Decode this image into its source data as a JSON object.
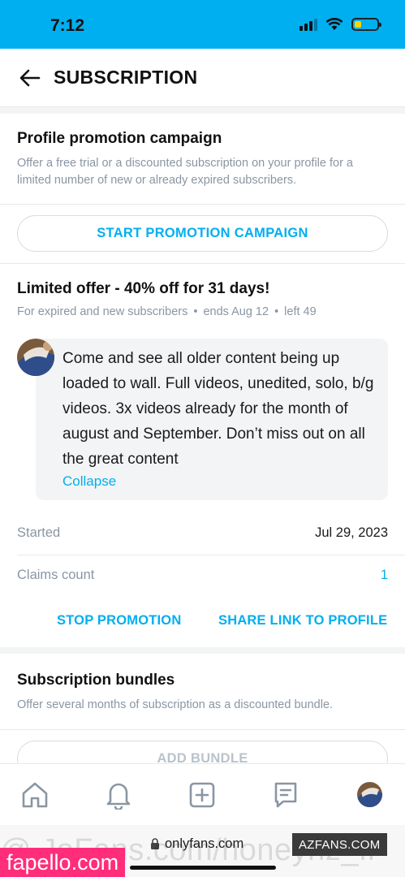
{
  "status_bar": {
    "time": "7:12"
  },
  "header": {
    "title": "SUBSCRIPTION",
    "back_icon": "arrow-left-icon"
  },
  "promotion": {
    "title": "Profile promotion campaign",
    "description": "Offer a free trial or a discounted subscription on your profile for a limited number of new or already expired subscribers.",
    "start_button": "START PROMOTION CAMPAIGN"
  },
  "offer": {
    "title": "Limited offer - 40% off for 31 days!",
    "audience": "For expired and new subscribers",
    "ends": "ends Aug 12",
    "left": "left 49",
    "message": "Come and see all older content being up loaded to wall. Full videos, unedited, solo, b/g videos. 3x videos already for the month of august and September. Don’t miss out on all the great content",
    "collapse_label": "Collapse",
    "started_label": "Started",
    "started_value": "Jul 29, 2023",
    "claims_label": "Claims count",
    "claims_value": "1",
    "stop_button": "STOP PROMOTION",
    "share_button": "SHARE LINK TO PROFILE"
  },
  "bundles": {
    "title": "Subscription bundles",
    "description": "Offer several months of subscription as a discounted bundle.",
    "add_button": "ADD BUNDLE"
  },
  "bottom_nav": {
    "items": [
      "home-icon",
      "bell-icon",
      "add-post-icon",
      "messages-icon",
      "profile-avatar"
    ]
  },
  "browser": {
    "url": "onlyfans.com"
  },
  "watermarks": {
    "ghost": "@ JoFans.com/honeynz_fr",
    "left": "fapello.com",
    "right": "AZFANS.COM"
  },
  "colors": {
    "accent": "#00aff0",
    "muted": "#8a96a3",
    "divider": "#e6eaed"
  }
}
